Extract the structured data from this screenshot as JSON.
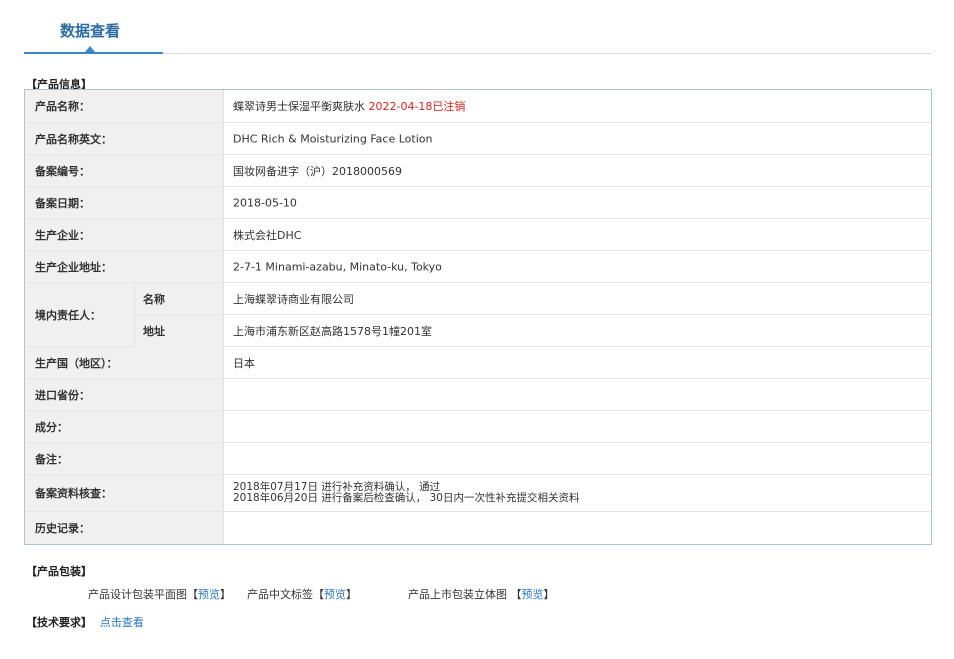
{
  "tab": {
    "label": "数据查看"
  },
  "product_info": {
    "section_title": "【产品信息】",
    "rows": {
      "name": {
        "label": "产品名称：",
        "value": "蝶翠诗男士保湿平衡爽肤水",
        "status": "2022-04-18已注销"
      },
      "name_en": {
        "label": "产品名称英文：",
        "value": "DHC Rich & Moisturizing Face Lotion"
      },
      "record_no": {
        "label": "备案编号：",
        "value": "国妆网备进字（沪）2018000569"
      },
      "record_date": {
        "label": "备案日期：",
        "value": "2018-05-10"
      },
      "manufacturer": {
        "label": "生产企业：",
        "value": "株式会社DHC"
      },
      "manufacturer_addr": {
        "label": "生产企业地址：",
        "value": "2-7-1 Minami-azabu, Minato-ku, Tokyo"
      },
      "domestic": {
        "label": "境内责任人：",
        "name_label": "名称",
        "name_value": "上海蝶翠诗商业有限公司",
        "addr_label": "地址",
        "addr_value": "上海市浦东新区赵高路1578号1幢201室"
      },
      "country": {
        "label": "生产国（地区）：",
        "value": "日本"
      },
      "import_province": {
        "label": "进口省份：",
        "value": ""
      },
      "ingredients": {
        "label": "成分：",
        "value": ""
      },
      "remarks": {
        "label": "备注：",
        "value": ""
      },
      "review": {
        "label": "备案资料核查：",
        "line1": "2018年07月17日 进行补充资料确认， 通过",
        "line2": "2018年06月20日 进行备案后检查确认， 30日内一次性补充提交相关资料"
      },
      "history": {
        "label": "历史记录：",
        "value": ""
      }
    }
  },
  "packaging": {
    "section_title": "【产品包装】",
    "items": [
      {
        "label": "产品设计包装平面图",
        "link": "预览"
      },
      {
        "label": "产品中文标签",
        "link": "预览"
      },
      {
        "label": "产品上市包装立体图",
        "link": "预览"
      }
    ]
  },
  "tech": {
    "section_title": "【技术要求】",
    "link": "点击查看"
  },
  "colors": {
    "accent": "#2e6da4",
    "link": "#2a76c2",
    "status_red": "#e02020",
    "table_border": "#a9c4dd"
  }
}
